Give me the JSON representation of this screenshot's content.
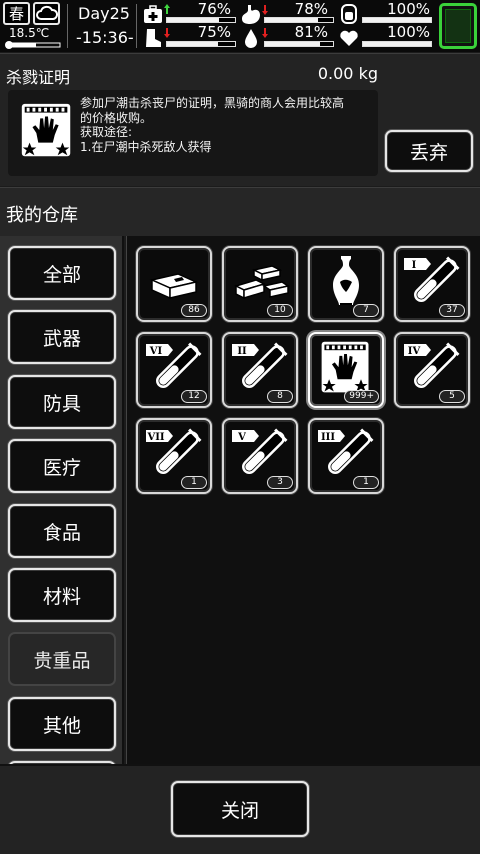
{
  "status": {
    "season": "春",
    "weather_icon": "cloudy-icon",
    "temperature": "18.5℃",
    "day": "Day25",
    "time": "-15:36-",
    "stats": [
      {
        "name": "health",
        "icon": "medkit-icon",
        "trend": "up",
        "percent": "76%",
        "level": 0.76
      },
      {
        "name": "hunger",
        "icon": "stomach-icon",
        "trend": "down",
        "percent": "78%",
        "level": 0.78
      },
      {
        "name": "energy",
        "icon": "canister-icon",
        "trend": "none",
        "percent": "100%",
        "level": 1.0
      },
      {
        "name": "stamina",
        "icon": "boot-icon",
        "trend": "down",
        "percent": "75%",
        "level": 0.75
      },
      {
        "name": "thirst",
        "icon": "water-drop-icon",
        "trend": "down",
        "percent": "81%",
        "level": 0.81
      },
      {
        "name": "mood",
        "icon": "heart-icon",
        "trend": "none",
        "percent": "100%",
        "level": 1.0
      }
    ],
    "battery_color": "#3ad13a"
  },
  "detail": {
    "name": "杀戮证明",
    "weight": "0.00 kg",
    "desc_line1": "参加尸潮击杀丧尸的证明，黑骑的商人会用比较高",
    "desc_line2": "的价格收购。",
    "desc_line3": "获取途径:",
    "desc_line4": "1.在尸潮中杀死敌人获得",
    "discard_label": "丢弃"
  },
  "warehouse": {
    "title": "我的仓库",
    "categories": [
      "全部",
      "武器",
      "防具",
      "医疗",
      "食品",
      "材料",
      "贵重品",
      "其他"
    ],
    "selected_category": "贵重品",
    "items": [
      {
        "icon": "silver-ingot-icon",
        "count": "86"
      },
      {
        "icon": "gold-bars-icon",
        "count": "10"
      },
      {
        "icon": "porcelain-vase-icon",
        "count": "7"
      },
      {
        "icon": "test-tube-icon",
        "roman": "I",
        "count": "37"
      },
      {
        "icon": "test-tube-icon",
        "roman": "VI",
        "count": "12"
      },
      {
        "icon": "test-tube-icon",
        "roman": "II",
        "count": "8"
      },
      {
        "icon": "kill-certificate-icon",
        "count": "999+"
      },
      {
        "icon": "test-tube-icon",
        "roman": "IV",
        "count": "5"
      },
      {
        "icon": "test-tube-icon",
        "roman": "VII",
        "count": "1"
      },
      {
        "icon": "test-tube-icon",
        "roman": "V",
        "count": "3"
      },
      {
        "icon": "test-tube-icon",
        "roman": "III",
        "count": "1"
      }
    ]
  },
  "footer": {
    "close_label": "关闭"
  },
  "colors": {
    "up_arrow": "#3fd63f",
    "down_arrow": "#e02020",
    "panel": "#232323",
    "grid_bg": "#101010"
  }
}
